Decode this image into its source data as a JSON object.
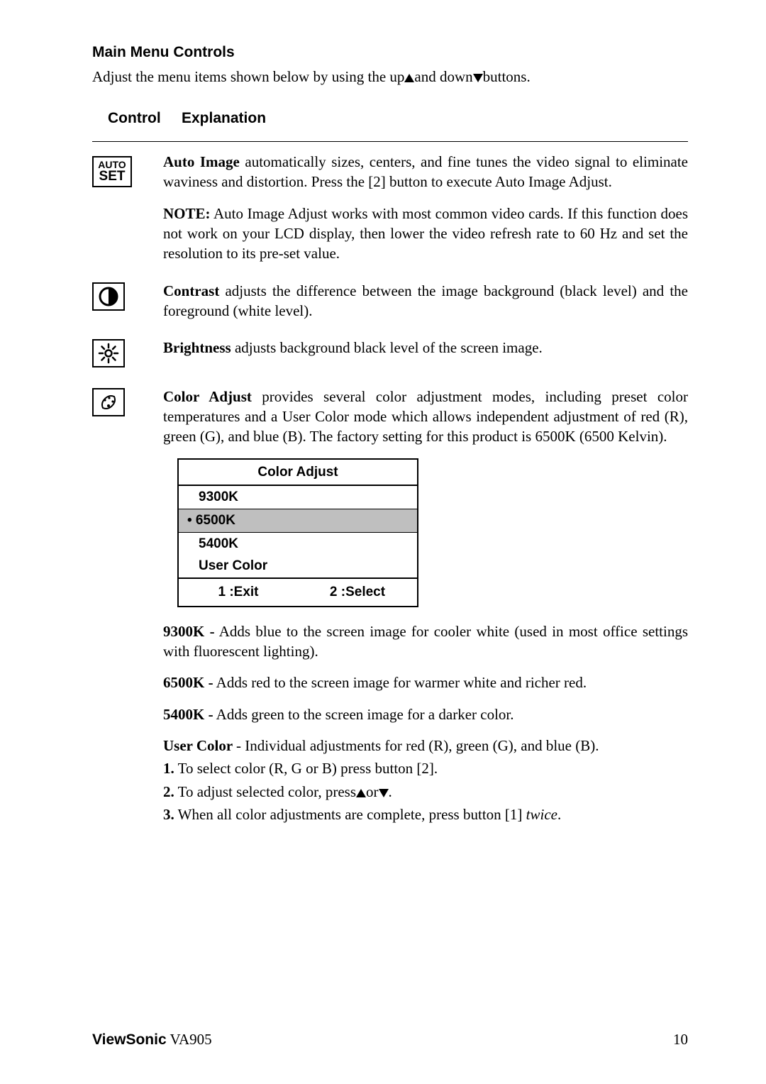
{
  "section_title": "Main Menu Controls",
  "intro_pre": "Adjust the menu items shown below by using the up",
  "intro_mid": "and down",
  "intro_post": "buttons.",
  "headers": {
    "c1": "Control",
    "c2": "Explanation"
  },
  "auto": {
    "icon_top": "AUTO",
    "icon_bottom": "SET",
    "p1a": "Auto Image",
    "p1b": " automatically sizes, centers, and fine tunes the video signal to eliminate waviness and distortion. Press the [2] button to execute Auto Image Adjust.",
    "p2a": "NOTE:",
    "p2b": " Auto Image Adjust works with most common video cards. If this function does not work on your LCD display, then lower the video refresh rate to 60 Hz and set the resolution to its pre-set value."
  },
  "contrast": {
    "la": "Contrast",
    "lb": " adjusts the difference between the image background  (black level) and the foreground (white level)."
  },
  "brightness": {
    "la": "Brightness",
    "lb": " adjusts background black level of the screen image."
  },
  "coloradjust": {
    "la": "Color Adjust",
    "lb": " provides several color adjustment modes, including preset color temperatures and a User Color mode which allows independent adjustment of red (R), green (G), and blue (B). The factory setting for this product is 6500K (6500 Kelvin)."
  },
  "menu": {
    "title": "Color Adjust",
    "opt1": "9300K",
    "opt2": "• 6500K",
    "opt3": "5400K",
    "opt4": "User Color",
    "f1": "1 :Exit",
    "f2": "2 :Select"
  },
  "k9300a": "9300K -",
  "k9300b": " Adds blue to the screen image for cooler white (used in most office settings with fluorescent lighting).",
  "k6500a": "6500K -",
  "k6500b": " Adds red to the screen image for warmer white and richer red.",
  "k5400a": "5400K -",
  "k5400b": " Adds green to the screen image for a darker color.",
  "ucA": "User Color ",
  "ucB": " - Individual adjustments for red (R), green (G),  and blue (B).",
  "s1a": "1.",
  "s1b": "  To select color (R, G or B) press button [2].",
  "s2a": "2.",
  "s2b_pre": "  To adjust selected color, press",
  "s2b_mid": "or",
  "s2b_post": ".",
  "s3a": "3.",
  "s3b_pre": "  When all color adjustments are complete, press button [1] ",
  "s3b_it": "twice",
  "s3b_post": ".",
  "footer": {
    "brand": "ViewSonic",
    "model": "  VA905",
    "page": "10"
  }
}
